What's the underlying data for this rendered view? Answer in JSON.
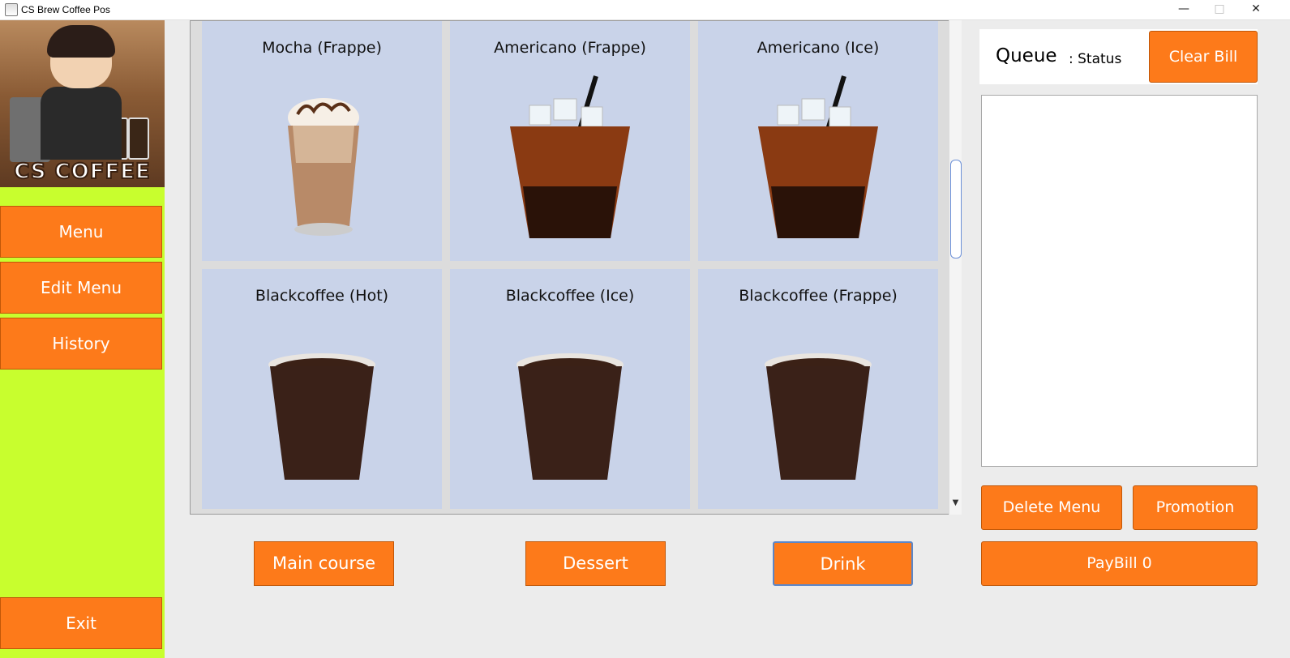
{
  "window": {
    "title": "CS Brew Coffee Pos",
    "minimize": "—",
    "maximize": "□",
    "close": "✕"
  },
  "sidebar": {
    "logo_text": "CS COFFEE",
    "buttons": {
      "menu": "Menu",
      "edit_menu": "Edit Menu",
      "history": "History",
      "exit": "Exit"
    }
  },
  "menu_items": [
    {
      "name": "Mocha (Frappe)",
      "image": "mocha-frappe-glass"
    },
    {
      "name": "Americano (Frappe)",
      "image": "iced-americano-cup"
    },
    {
      "name": "Americano (Ice)",
      "image": "iced-americano-cup"
    },
    {
      "name": "Blackcoffee (Hot)",
      "image": "blackcoffee-cup"
    },
    {
      "name": "Blackcoffee (Ice)",
      "image": "blackcoffee-cup"
    },
    {
      "name": "Blackcoffee (Frappe)",
      "image": "blackcoffee-cup"
    }
  ],
  "categories": {
    "main_course": "Main course",
    "dessert": "Dessert",
    "drink": "Drink"
  },
  "queue": {
    "label": "Queue",
    "status": ": Status"
  },
  "bill": {
    "clear": "Clear Bill",
    "delete_menu": "Delete Menu",
    "promotion": "Promotion",
    "paybill": "PayBill 0"
  },
  "colors": {
    "accent": "#fd7a1a",
    "sidebar": "#c8fe2e",
    "card": "#c9d3e9"
  }
}
